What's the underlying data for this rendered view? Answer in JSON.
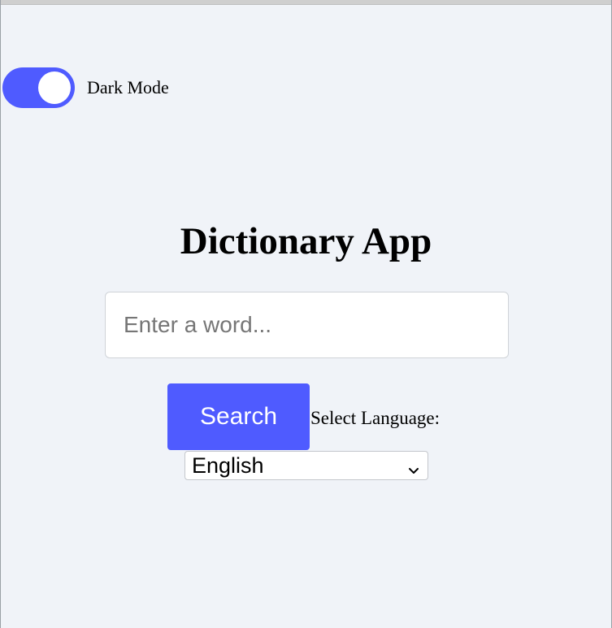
{
  "dark_mode": {
    "label": "Dark Mode",
    "enabled": true,
    "accent": "#4f5bff"
  },
  "main": {
    "title": "Dictionary App",
    "search": {
      "placeholder": "Enter a word...",
      "value": ""
    },
    "search_button_label": "Search",
    "language": {
      "label": "Select Language:",
      "selected": "English"
    }
  },
  "colors": {
    "background": "#f0f3f8",
    "primary": "#4f5bff",
    "input_background": "#ffffff"
  },
  "icons": {
    "language_select": "chevron-down-icon"
  }
}
